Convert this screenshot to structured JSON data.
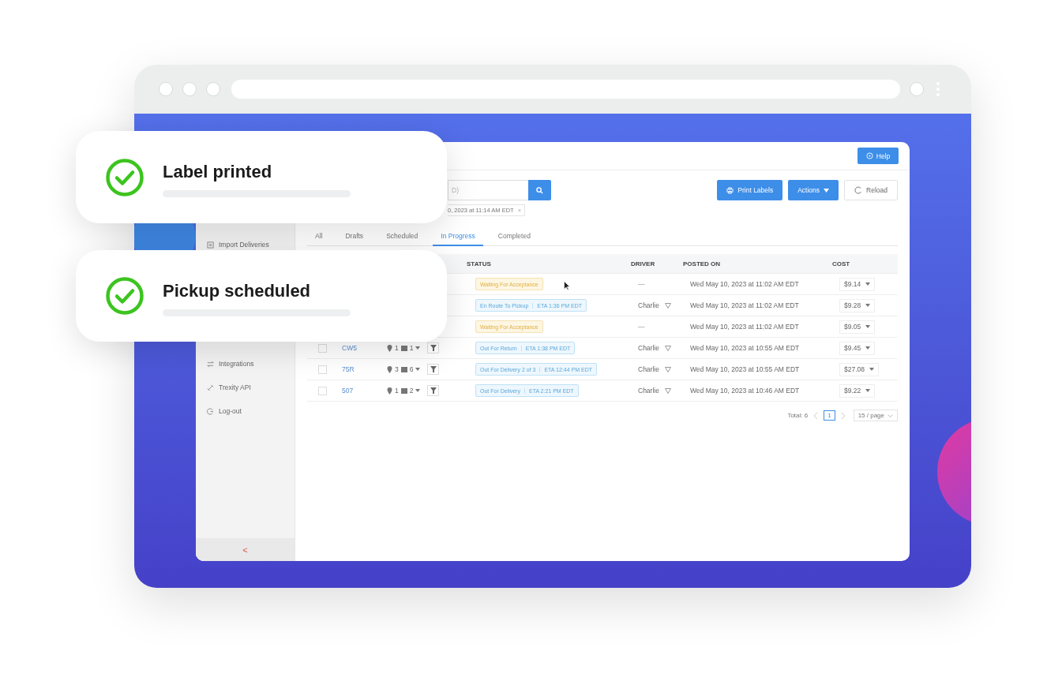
{
  "cards": [
    {
      "title": "Label printed",
      "checked": true
    },
    {
      "title": "Pickup scheduled",
      "checked": true
    }
  ],
  "app": {
    "help_button": "Help",
    "sidebar": {
      "items": [
        {
          "label": "Import Deliveries"
        },
        {
          "label": "Integrations"
        },
        {
          "label": "Trexity API"
        },
        {
          "label": "Log-out"
        }
      ],
      "collapse": "<"
    },
    "search": {
      "placeholder": "D)"
    },
    "buttons": [
      {
        "label": "Print Labels",
        "kind": "print"
      },
      {
        "label": "Actions",
        "kind": "dropdown"
      },
      {
        "label": "Reload",
        "kind": "reload"
      }
    ],
    "filter_tag": {
      "label": "0, 2023 at 11:14 AM EDT",
      "close": "×"
    },
    "tabs": [
      {
        "label": "All",
        "selected": false
      },
      {
        "label": "Drafts",
        "selected": false
      },
      {
        "label": "Scheduled",
        "selected": false
      },
      {
        "label": "In Progress",
        "selected": true
      },
      {
        "label": "Completed",
        "selected": false
      }
    ],
    "table": {
      "columns": [
        "STATUS",
        "DRIVER",
        "POSTED ON",
        "COST"
      ],
      "rows": [
        {
          "status": "Waiting For Acceptance",
          "kind": "waiting",
          "driver": "—",
          "assigned": false,
          "posted": "Wed May 10, 2023 at 11:02 AM EDT",
          "cost": "$9.14"
        },
        {
          "status": "En Route To Pickup",
          "eta": "ETA 1:36 PM EDT",
          "kind": "active",
          "driver": "Charlie",
          "assigned": true,
          "posted": "Wed May 10, 2023 at 11:02 AM EDT",
          "cost": "$9.28"
        },
        {
          "status": "Waiting For Acceptance",
          "kind": "waiting",
          "driver": "—",
          "assigned": false,
          "posted": "Wed May 10, 2023 at 11:02 AM EDT",
          "cost": "$9.05"
        },
        {
          "id": "CW5",
          "checked": false,
          "stops": "1",
          "packages": "1",
          "status": "Out For Return",
          "eta": "ETA 1:38 PM EDT",
          "kind": "active",
          "driver": "Charlie",
          "assigned": true,
          "posted": "Wed May 10, 2023 at 10:55 AM EDT",
          "cost": "$9.45"
        },
        {
          "id": "75R",
          "checked": false,
          "stops": "3",
          "packages": "6",
          "status": "Out For Delivery 2 of 3",
          "eta": "ETA 12:44 PM EDT",
          "kind": "active",
          "driver": "Charlie",
          "assigned": true,
          "posted": "Wed May 10, 2023 at 10:55 AM EDT",
          "cost": "$27.08"
        },
        {
          "id": "507",
          "checked": false,
          "stops": "1",
          "packages": "2",
          "status": "Out For Delivery",
          "eta": "ETA 2:21 PM EDT",
          "kind": "active",
          "driver": "Charlie",
          "assigned": true,
          "posted": "Wed May 10, 2023 at 10:46 AM EDT",
          "cost": "$9.22"
        }
      ]
    },
    "pagination": {
      "total": "Total: 6",
      "page": "1",
      "page_size": "15 / page"
    }
  }
}
